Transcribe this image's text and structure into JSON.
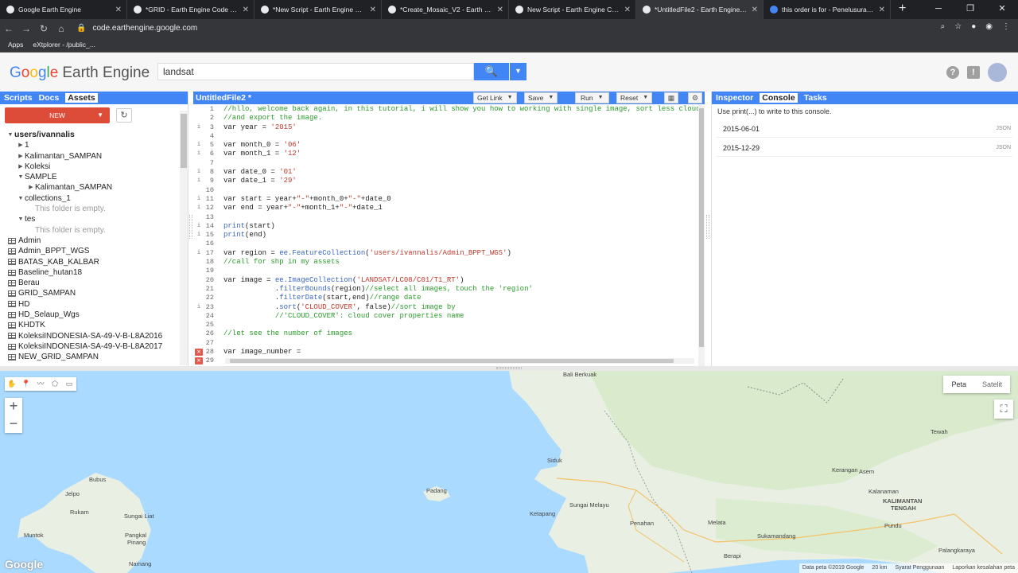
{
  "browser": {
    "tabs": [
      {
        "title": "Google Earth Engine",
        "active": false
      },
      {
        "title": "*GRID - Earth Engine Code Editor",
        "active": false
      },
      {
        "title": "*New Script - Earth Engine Code",
        "active": false
      },
      {
        "title": "*Create_Mosaic_V2 - Earth Engin",
        "active": false
      },
      {
        "title": "New Script - Earth Engine Code E",
        "active": false
      },
      {
        "title": "*UntitledFile2 - Earth Engine Co",
        "active": true
      },
      {
        "title": "this order is for - Penelusuran G",
        "active": false
      }
    ],
    "url": "code.earthengine.google.com",
    "bookmarks": [
      "Apps",
      "eXtplorer - /public_..."
    ]
  },
  "header": {
    "logo_google": "Google",
    "logo_product": "Earth Engine",
    "search_value": "landsat"
  },
  "left_panel": {
    "tabs": [
      "Scripts",
      "Docs",
      "Assets"
    ],
    "active_tab": "Assets",
    "new_label": "NEW",
    "tree": [
      {
        "label": "users/ivannalis",
        "kind": "user",
        "indent": 0,
        "caret": "▼"
      },
      {
        "label": "1",
        "kind": "folder",
        "indent": 1,
        "caret": "▶"
      },
      {
        "label": "Kalimantan_SAMPAN",
        "kind": "folder",
        "indent": 1,
        "caret": "▶"
      },
      {
        "label": "Koleksi",
        "kind": "folder",
        "indent": 1,
        "caret": "▶"
      },
      {
        "label": "SAMPLE",
        "kind": "folder",
        "indent": 1,
        "caret": "▼"
      },
      {
        "label": "Kalimantan_SAMPAN",
        "kind": "folder",
        "indent": 2,
        "caret": "▶"
      },
      {
        "label": "collections_1",
        "kind": "folder",
        "indent": 1,
        "caret": "▼"
      },
      {
        "label": "This folder is empty.",
        "kind": "empty",
        "indent": 2,
        "caret": ""
      },
      {
        "label": "tes",
        "kind": "folder",
        "indent": 1,
        "caret": "▼"
      },
      {
        "label": "This folder is empty.",
        "kind": "empty",
        "indent": 2,
        "caret": ""
      },
      {
        "label": "Admin",
        "kind": "table",
        "indent": 1,
        "caret": ""
      },
      {
        "label": "Admin_BPPT_WGS",
        "kind": "table",
        "indent": 1,
        "caret": ""
      },
      {
        "label": "BATAS_KAB_KALBAR",
        "kind": "table",
        "indent": 1,
        "caret": ""
      },
      {
        "label": "Baseline_hutan18",
        "kind": "table",
        "indent": 1,
        "caret": ""
      },
      {
        "label": "Berau",
        "kind": "table",
        "indent": 1,
        "caret": ""
      },
      {
        "label": "GRID_SAMPAN",
        "kind": "table",
        "indent": 1,
        "caret": ""
      },
      {
        "label": "HD",
        "kind": "table",
        "indent": 1,
        "caret": ""
      },
      {
        "label": "HD_Selaup_Wgs",
        "kind": "table",
        "indent": 1,
        "caret": ""
      },
      {
        "label": "KHDTK",
        "kind": "table",
        "indent": 1,
        "caret": ""
      },
      {
        "label": "KoleksiINDONESIA-SA-49-V-B-L8A2016",
        "kind": "table",
        "indent": 1,
        "caret": ""
      },
      {
        "label": "KoleksiINDONESIA-SA-49-V-B-L8A2017",
        "kind": "table",
        "indent": 1,
        "caret": ""
      },
      {
        "label": "NEW_GRID_SAMPAN",
        "kind": "table",
        "indent": 1,
        "caret": ""
      }
    ]
  },
  "editor": {
    "title": "UntitledFile2 *",
    "buttons": {
      "get_link": "Get Link",
      "save": "Save",
      "run": "Run",
      "reset": "Reset"
    },
    "lines": [
      {
        "n": "1",
        "gutter": "",
        "parts": [
          [
            "c-cmt",
            "//hllo, welcome back again, in this tutorial, i will show you how to working with single image, sort less cloud co"
          ]
        ]
      },
      {
        "n": "2",
        "gutter": "",
        "parts": [
          [
            "c-cmt",
            "//and export the image."
          ]
        ]
      },
      {
        "n": "3",
        "gutter": "i",
        "parts": [
          [
            "c-kw",
            "var year = "
          ],
          [
            "c-str",
            "'2015'"
          ]
        ]
      },
      {
        "n": "4",
        "gutter": "",
        "parts": []
      },
      {
        "n": "5",
        "gutter": "i",
        "parts": [
          [
            "c-kw",
            "var month_0 = "
          ],
          [
            "c-str",
            "'06'"
          ]
        ]
      },
      {
        "n": "6",
        "gutter": "i",
        "parts": [
          [
            "c-kw",
            "var month_1 = "
          ],
          [
            "c-str",
            "'12'"
          ]
        ]
      },
      {
        "n": "7",
        "gutter": "",
        "parts": []
      },
      {
        "n": "8",
        "gutter": "i",
        "parts": [
          [
            "c-kw",
            "var date_0 = "
          ],
          [
            "c-str",
            "'01'"
          ]
        ]
      },
      {
        "n": "9",
        "gutter": "i",
        "parts": [
          [
            "c-kw",
            "var date_1 = "
          ],
          [
            "c-str",
            "'29'"
          ]
        ]
      },
      {
        "n": "10",
        "gutter": "",
        "parts": []
      },
      {
        "n": "11",
        "gutter": "i",
        "parts": [
          [
            "c-kw",
            "var start = year+"
          ],
          [
            "c-str",
            "\"-\""
          ],
          [
            "c-kw",
            "+month_0+"
          ],
          [
            "c-str",
            "\"-\""
          ],
          [
            "c-kw",
            "+date_0"
          ]
        ]
      },
      {
        "n": "12",
        "gutter": "i",
        "parts": [
          [
            "c-kw",
            "var end = year+"
          ],
          [
            "c-str",
            "\"-\""
          ],
          [
            "c-kw",
            "+month_1+"
          ],
          [
            "c-str",
            "\"-\""
          ],
          [
            "c-kw",
            "+date_1"
          ]
        ]
      },
      {
        "n": "13",
        "gutter": "",
        "parts": []
      },
      {
        "n": "14",
        "gutter": "i",
        "parts": [
          [
            "c-fn",
            "print"
          ],
          [
            "c-kw",
            "(start)"
          ]
        ]
      },
      {
        "n": "15",
        "gutter": "i",
        "parts": [
          [
            "c-fn",
            "print"
          ],
          [
            "c-kw",
            "(end)"
          ]
        ]
      },
      {
        "n": "16",
        "gutter": "",
        "parts": []
      },
      {
        "n": "17",
        "gutter": "i",
        "parts": [
          [
            "c-kw",
            "var region = "
          ],
          [
            "c-fn",
            "ee.FeatureCollection"
          ],
          [
            "c-kw",
            "("
          ],
          [
            "c-str",
            "'users/ivannalis/Admin_BPPT_WGS'"
          ],
          [
            "c-kw",
            ")"
          ]
        ]
      },
      {
        "n": "18",
        "gutter": "",
        "parts": [
          [
            "c-cmt",
            "//call for shp in my assets"
          ]
        ]
      },
      {
        "n": "19",
        "gutter": "",
        "parts": []
      },
      {
        "n": "20",
        "gutter": "",
        "parts": [
          [
            "c-kw",
            "var image = "
          ],
          [
            "c-fn",
            "ee.ImageCollection"
          ],
          [
            "c-kw",
            "("
          ],
          [
            "c-str",
            "'LANDSAT/LC08/C01/T1_RT'"
          ],
          [
            "c-kw",
            ")"
          ]
        ]
      },
      {
        "n": "21",
        "gutter": "",
        "parts": [
          [
            "c-kw",
            "            ."
          ],
          [
            "c-fn",
            "filterBounds"
          ],
          [
            "c-kw",
            "(region)"
          ],
          [
            "c-cmt",
            "//select all images, touch the 'region'"
          ]
        ]
      },
      {
        "n": "22",
        "gutter": "",
        "parts": [
          [
            "c-kw",
            "            ."
          ],
          [
            "c-fn",
            "filterDate"
          ],
          [
            "c-kw",
            "(start,end)"
          ],
          [
            "c-cmt",
            "//range date"
          ]
        ]
      },
      {
        "n": "23",
        "gutter": "i",
        "parts": [
          [
            "c-kw",
            "            ."
          ],
          [
            "c-fn",
            "sort"
          ],
          [
            "c-kw",
            "("
          ],
          [
            "c-str",
            "'CLOUD_COVER'"
          ],
          [
            "c-kw",
            ", false)"
          ],
          [
            "c-cmt",
            "//sort image by"
          ]
        ]
      },
      {
        "n": "24",
        "gutter": "",
        "parts": [
          [
            "c-kw",
            "            "
          ],
          [
            "c-cmt",
            "//'CLOUD_COVER': cloud cover properties name"
          ]
        ]
      },
      {
        "n": "25",
        "gutter": "",
        "parts": []
      },
      {
        "n": "26",
        "gutter": "",
        "parts": [
          [
            "c-cmt",
            "//let see the number of images"
          ]
        ]
      },
      {
        "n": "27",
        "gutter": "",
        "parts": []
      },
      {
        "n": "28",
        "gutter": "x",
        "parts": [
          [
            "c-kw",
            "var image_number = "
          ]
        ]
      },
      {
        "n": "29",
        "gutter": "x",
        "parts": []
      }
    ]
  },
  "right_panel": {
    "tabs": [
      "Inspector",
      "Console",
      "Tasks"
    ],
    "active_tab": "Console",
    "hint": "Use print(...) to write to this console.",
    "outputs": [
      {
        "value": "2015-06-01",
        "tag": "JSON"
      },
      {
        "value": "2015-12-29",
        "tag": "JSON"
      }
    ]
  },
  "map": {
    "map_types": [
      "Peta",
      "Satelit"
    ],
    "active_type": "Peta",
    "watermark": "Google",
    "labels": [
      {
        "text": "Bali Berkuak",
        "bold": false
      },
      {
        "text": "Tewah",
        "bold": false
      },
      {
        "text": "Siduk",
        "bold": false
      },
      {
        "text": "Bubus",
        "bold": false
      },
      {
        "text": "Jelpo",
        "bold": false
      },
      {
        "text": "Rukam",
        "bold": false
      },
      {
        "text": "Sungai Liat",
        "bold": false
      },
      {
        "text": "Padang",
        "bold": false
      },
      {
        "text": "Sungai Melayu",
        "bold": false
      },
      {
        "text": "Ketapang",
        "bold": false
      },
      {
        "text": "Kerangan",
        "bold": false
      },
      {
        "text": "Asem",
        "bold": false
      },
      {
        "text": "Kalanaman",
        "bold": false
      },
      {
        "text": "KALIMANTAN",
        "bold": true
      },
      {
        "text": "TENGAH",
        "bold": true
      },
      {
        "text": "Pundu",
        "bold": false
      },
      {
        "text": "Muntok",
        "bold": false
      },
      {
        "text": "Pangkal",
        "bold": false
      },
      {
        "text": "Pinang",
        "bold": false
      },
      {
        "text": "Penahan",
        "bold": false
      },
      {
        "text": "Melata",
        "bold": false
      },
      {
        "text": "Sukamandang",
        "bold": false
      },
      {
        "text": "Palangkaraya",
        "bold": false
      },
      {
        "text": "Berapi",
        "bold": false
      },
      {
        "text": "Namang",
        "bold": false
      }
    ],
    "attribution": [
      "Data peta ©2019 Google",
      "20 km",
      "Syarat Penggunaan",
      "Laporkan kesalahan peta"
    ]
  }
}
